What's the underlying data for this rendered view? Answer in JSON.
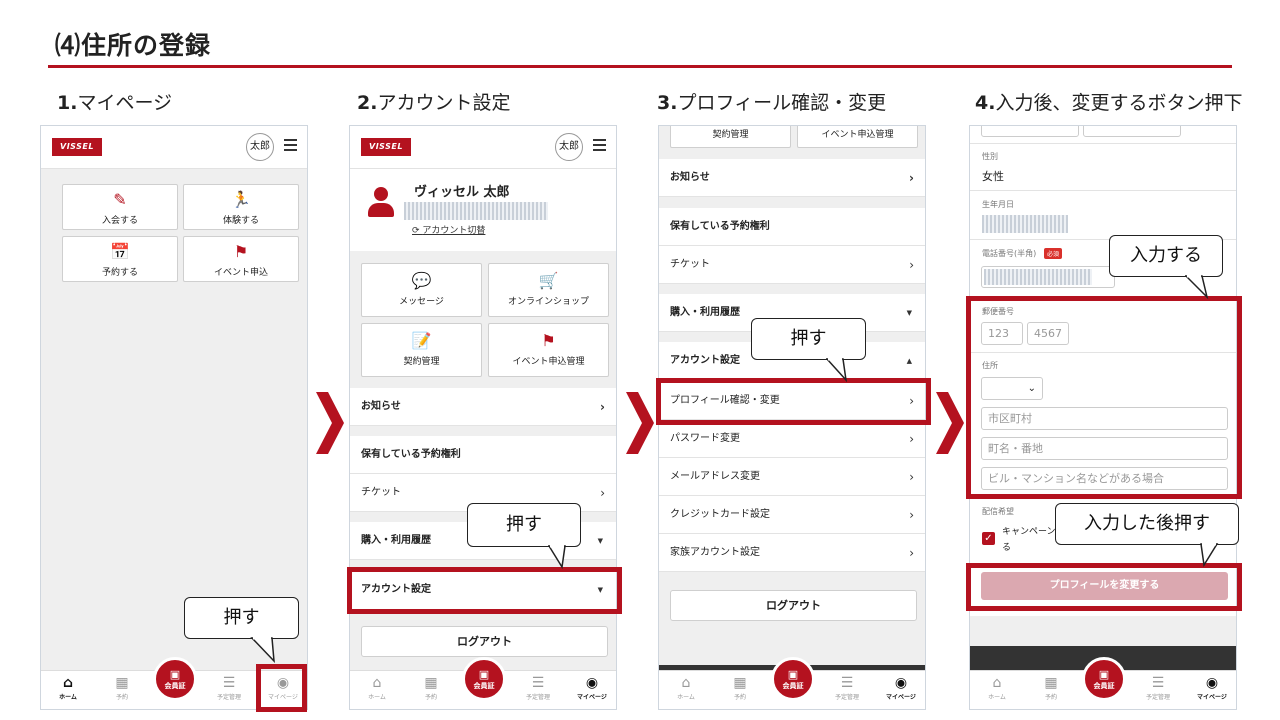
{
  "page": {
    "title": "⑷住所の登録"
  },
  "steps": [
    {
      "num": "1.",
      "label": "マイページ"
    },
    {
      "num": "2.",
      "label": "アカウント設定"
    },
    {
      "num": "3.",
      "label": "プロフィール確認・変更"
    },
    {
      "num": "4.",
      "label": "入力後、変更するボタン押下"
    }
  ],
  "common": {
    "logo": "VISSEL",
    "user_short": "太郎",
    "tabs": [
      "ホーム",
      "予約",
      "会員証",
      "予定管理",
      "マイページ"
    ],
    "logout": "ログアウト"
  },
  "phone1": {
    "buttons": [
      "入会する",
      "体験する",
      "予約する",
      "イベント申込"
    ]
  },
  "phone2": {
    "user_name": "ヴィッセル 太郎",
    "switch_account": "アカウント切替",
    "buttons": [
      "メッセージ",
      "オンラインショップ",
      "契約管理",
      "イベント申込管理"
    ],
    "rows": {
      "news": "お知らせ",
      "rights_header": "保有している予約権利",
      "ticket": "チケット",
      "history": "購入・利用履歴",
      "account": "アカウント設定"
    }
  },
  "phone3": {
    "top_buttons": [
      "契約管理",
      "イベント申込管理"
    ],
    "rows": {
      "news": "お知らせ",
      "rights_header": "保有している予約権利",
      "ticket": "チケット",
      "history": "購入・利用履歴",
      "account": "アカウント設定",
      "profile": "プロフィール確認・変更",
      "password": "パスワード変更",
      "email": "メールアドレス変更",
      "card": "クレジットカード設定",
      "family": "家族アカウント設定"
    }
  },
  "phone4": {
    "gender_label": "性別",
    "gender_value": "女性",
    "birth_label": "生年月日",
    "phone_label": "電話番号(半角)",
    "required": "必須",
    "zip_label": "郵便番号",
    "zip1": "123",
    "zip2": "4567",
    "address_label": "住所",
    "city_placeholder": "市区町村",
    "street_placeholder": "町名・番地",
    "building_placeholder": "ビル・マンション名などがある場合",
    "delivery_label": "配信希望",
    "campaign_text": "キャンペーン",
    "campaign_text2": "る",
    "submit": "プロフィールを変更する"
  },
  "callouts": {
    "press": "押す",
    "input": "入力する",
    "press_after_input": "入力した後押す"
  },
  "colors": {
    "brand": "#b4121f",
    "highlight": "#b4121f"
  }
}
